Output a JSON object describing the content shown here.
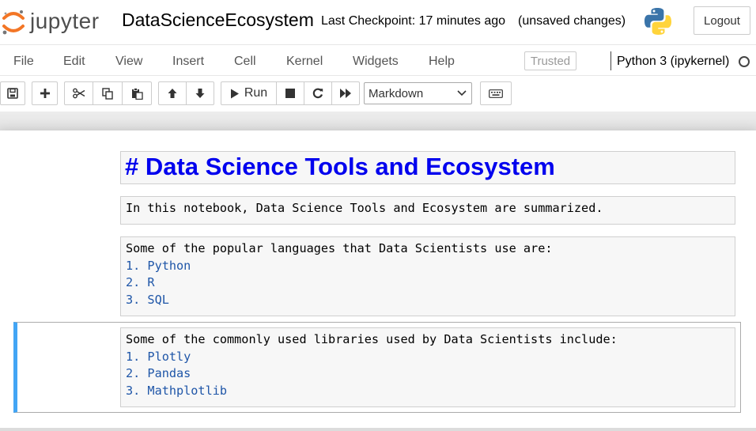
{
  "header": {
    "logo_text": "jupyter",
    "notebook_title": "DataScienceEcosystem",
    "checkpoint": "Last Checkpoint: 17 minutes ago",
    "autosave_status": "(unsaved changes)",
    "logout_label": "Logout"
  },
  "menubar": {
    "items": [
      "File",
      "Edit",
      "View",
      "Insert",
      "Cell",
      "Kernel",
      "Widgets",
      "Help"
    ],
    "trusted_label": "Trusted",
    "kernel_name": "Python 3 (ipykernel)"
  },
  "toolbar": {
    "buttons": [
      "save-icon",
      "plus-icon",
      "scissors-icon",
      "copy-icon",
      "paste-icon",
      "arrow-up-icon",
      "arrow-down-icon",
      "run-icon",
      "stop-icon",
      "restart-icon",
      "fast-forward-icon",
      "keyboard-icon"
    ],
    "run_label": "Run",
    "cell_type_selected": "Markdown"
  },
  "cells": {
    "heading": "# Data Science Tools and Ecosystem",
    "intro": "In this notebook, Data Science Tools and Ecosystem are summarized.",
    "languages_intro": "Some of the popular languages that Data Scientists use are:",
    "languages": [
      "1. Python",
      "2. R",
      "3. SQL"
    ],
    "libraries_intro": "Some of the commonly used libraries used by Data Scientists include:",
    "libraries": [
      "1. Plotly",
      "2. Pandas",
      "3. Mathplotlib"
    ]
  },
  "colors": {
    "heading_blue": "#0000ee",
    "list_blue": "#1f56a8",
    "selected_cell_border": "#42a5f5",
    "logo_orange": "#f37626"
  }
}
